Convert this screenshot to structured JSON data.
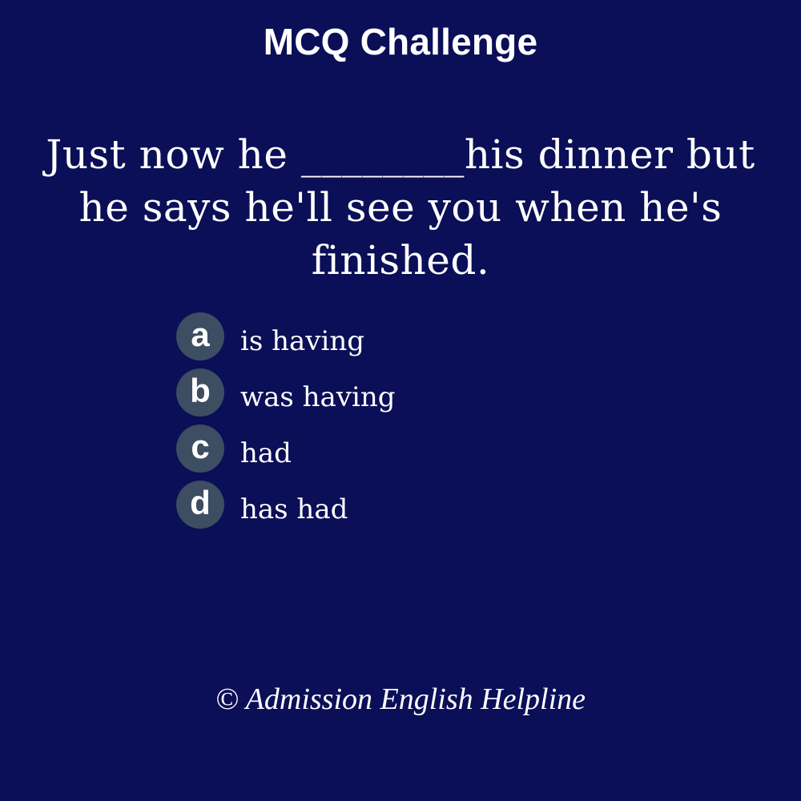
{
  "header": {
    "title": "MCQ Challenge"
  },
  "question": {
    "text": "Just now he ________his dinner but he says he'll see you when he's finished."
  },
  "options": [
    {
      "letter": "a",
      "text": "is having"
    },
    {
      "letter": "b",
      "text": "was having"
    },
    {
      "letter": "c",
      "text": "had"
    },
    {
      "letter": "d",
      "text": "has had"
    }
  ],
  "footer": {
    "copyright": "© Admission English Helpline"
  },
  "colors": {
    "background": "#0a0f57",
    "badge": "#3d4d62",
    "text": "#ffffff"
  }
}
